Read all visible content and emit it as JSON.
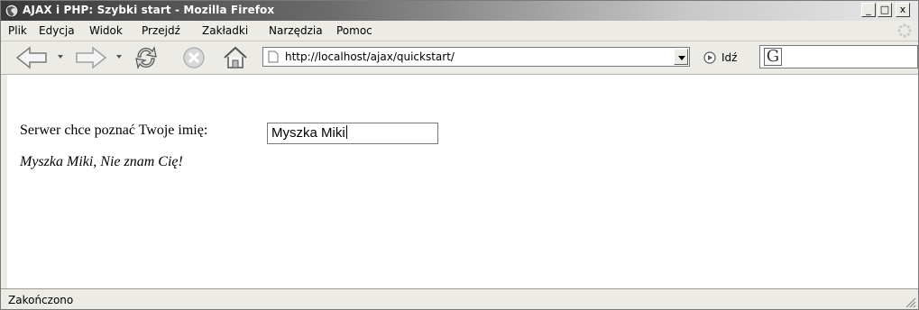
{
  "window": {
    "title": "AJAX i PHP: Szybki start - Mozilla Firefox",
    "controls": {
      "minimize": "_",
      "maximize": "□",
      "close": "x"
    }
  },
  "menu": {
    "items": [
      {
        "label": "Plik"
      },
      {
        "label": "Edycja"
      },
      {
        "label": "Widok"
      },
      {
        "label": "Przejdź"
      },
      {
        "label": "Zakładki"
      },
      {
        "label": "Narzędzia"
      },
      {
        "label": "Pomoc"
      }
    ]
  },
  "toolbar": {
    "icons": [
      "back-icon",
      "forward-icon",
      "reload-icon",
      "stop-icon",
      "home-icon"
    ],
    "url": "http://localhost/ajax/quickstart/",
    "go_label": "Idź",
    "search_engine_glyph": "G"
  },
  "page": {
    "prompt": "Serwer chce poznać Twoje imię:",
    "name_value": "Myszka Miki",
    "response": "Myszka Miki, Nie znam Cię!"
  },
  "status": {
    "text": "Zakończono"
  }
}
